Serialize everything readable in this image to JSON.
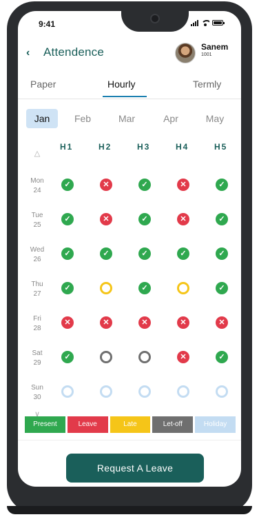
{
  "status": {
    "time": "9:41"
  },
  "header": {
    "back_icon": "back-arrow-icon",
    "title": "Attendence",
    "user_name": "Sanem",
    "user_id": "1001"
  },
  "tabs": [
    {
      "label": "Paper"
    },
    {
      "label": "Hourly",
      "active": true
    },
    {
      "label": "Termly"
    }
  ],
  "months": [
    {
      "label": "Jan",
      "active": true
    },
    {
      "label": "Feb"
    },
    {
      "label": "Mar"
    },
    {
      "label": "Apr"
    },
    {
      "label": "May"
    }
  ],
  "hours": [
    "H1",
    "H2",
    "H3",
    "H4",
    "H5"
  ],
  "days": [
    {
      "day": "Mon",
      "date": "24",
      "marks": [
        "present",
        "leave",
        "present",
        "leave",
        "present"
      ]
    },
    {
      "day": "Tue",
      "date": "25",
      "marks": [
        "present",
        "leave",
        "present",
        "leave",
        "present"
      ]
    },
    {
      "day": "Wed",
      "date": "26",
      "marks": [
        "present",
        "present",
        "present",
        "present",
        "present"
      ]
    },
    {
      "day": "Thu",
      "date": "27",
      "marks": [
        "present",
        "late",
        "present",
        "late",
        "present"
      ]
    },
    {
      "day": "Fri",
      "date": "28",
      "marks": [
        "leave",
        "leave",
        "leave",
        "leave",
        "leave"
      ]
    },
    {
      "day": "Sat",
      "date": "29",
      "marks": [
        "present",
        "letoff",
        "letoff",
        "leave",
        "present"
      ]
    },
    {
      "day": "Sun",
      "date": "30",
      "marks": [
        "holiday",
        "holiday",
        "holiday",
        "holiday",
        "holiday"
      ]
    }
  ],
  "legend": [
    {
      "label": "Present",
      "status": "present",
      "color": "#2fa84f"
    },
    {
      "label": "Leave",
      "status": "leave",
      "color": "#e23a4a"
    },
    {
      "label": "Late",
      "status": "late",
      "color": "#f5c518"
    },
    {
      "label": "Let-off",
      "status": "letoff",
      "color": "#6f6f6f"
    },
    {
      "label": "Holiday",
      "status": "holiday",
      "color": "#c3dcf2"
    }
  ],
  "request_button": {
    "label": "Request A Leave"
  }
}
